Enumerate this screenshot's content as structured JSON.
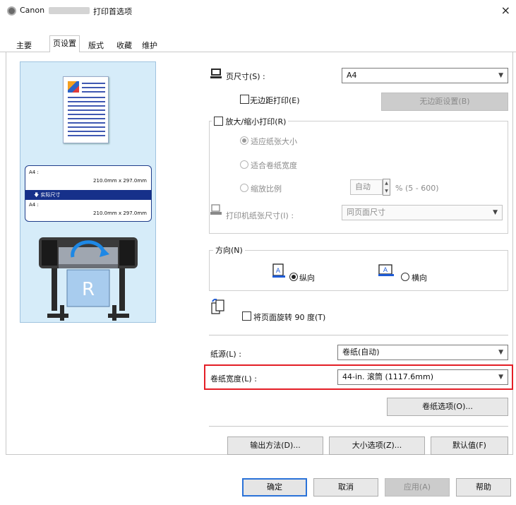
{
  "window": {
    "brand": "Canon",
    "title": "打印首选项",
    "close": "×"
  },
  "tabs": [
    "主要",
    "页设置",
    "版式",
    "收藏",
    "维护"
  ],
  "preview": {
    "size_label_top": "A4 :",
    "size_value_top": "210.0mm x 297.0mm",
    "banner": "实际尺寸",
    "size_label_bottom": "A4 :",
    "size_value_bottom": "210.0mm x 297.0mm",
    "printer_mark": "R"
  },
  "page_setup": {
    "page_size_label": "页尺寸(S) :",
    "page_size_value": "A4",
    "borderless_label": "无边距打印(E)",
    "borderless_settings_button": "无边距设置(B)",
    "enlarge_reduce_label": "放大/缩小打印(R)",
    "fit_paper_size": "适应纸张大小",
    "fit_roll_width": "适合卷纸宽度",
    "scaling": "缩放比例",
    "scaling_value": "自动",
    "scaling_range": "% (5 - 600)",
    "printer_paper_size_label": "打印机纸张尺寸(I) :",
    "printer_paper_size_value": "同页面尺寸"
  },
  "orientation": {
    "label": "方向(N)",
    "portrait": "纵向",
    "landscape": "横向",
    "rotate_label": "将页面旋转 90 度(T)"
  },
  "paper_source": {
    "label": "纸源(L) :",
    "value": "卷纸(自动)"
  },
  "roll_width": {
    "label": "卷纸宽度(L) :",
    "value": "44-in. 滚筒 (1117.6mm)",
    "highlight_color": "#e41e26"
  },
  "buttons": {
    "roll_options": "卷纸选项(O)...",
    "output_method": "输出方法(D)...",
    "size_options": "大小选项(Z)...",
    "defaults": "默认值(F)",
    "ok": "确定",
    "cancel": "取消",
    "apply": "应用(A)",
    "help": "帮助"
  },
  "colors": {
    "accent": "#2a72d8",
    "preview_bg": "#d6ecf9",
    "banner": "#16308a"
  }
}
